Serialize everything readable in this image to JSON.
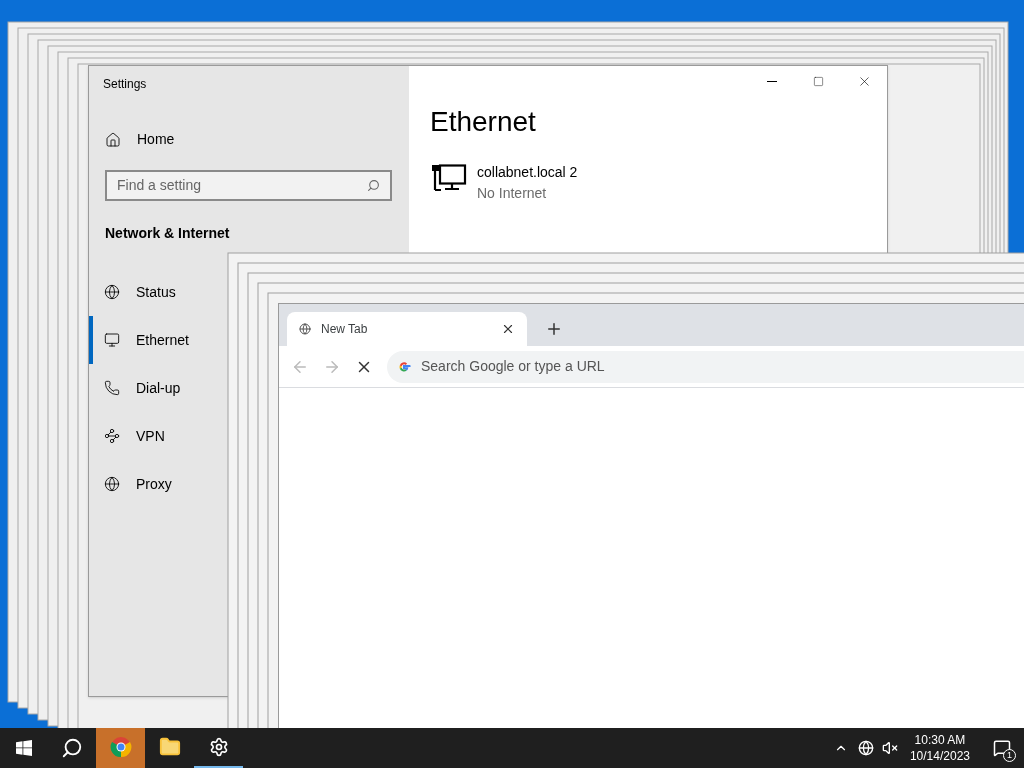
{
  "settings": {
    "title": "Settings",
    "home": "Home",
    "search": {
      "placeholder": "Find a setting"
    },
    "section": "Network & Internet",
    "nav": [
      {
        "label": "Status",
        "selected": false
      },
      {
        "label": "Ethernet",
        "selected": true
      },
      {
        "label": "Dial-up",
        "selected": false
      },
      {
        "label": "VPN",
        "selected": false
      },
      {
        "label": "Proxy",
        "selected": false
      }
    ],
    "page_title": "Ethernet",
    "connection": {
      "name": "collabnet.local 2",
      "status": "No Internet"
    }
  },
  "browser": {
    "tabs": [
      {
        "label": "New Tab",
        "selected": true
      }
    ],
    "omnibox": {
      "placeholder": "Search Google or type a URL"
    }
  },
  "taskbar": {
    "apps": [
      {
        "kind": "chrome",
        "flashing": true,
        "running": false
      },
      {
        "kind": "explorer",
        "flashing": false,
        "running": false
      },
      {
        "kind": "settings",
        "flashing": false,
        "running": true
      }
    ],
    "clock": {
      "time": "10:30 AM",
      "date": "10/14/2023"
    },
    "notifications": "1"
  }
}
